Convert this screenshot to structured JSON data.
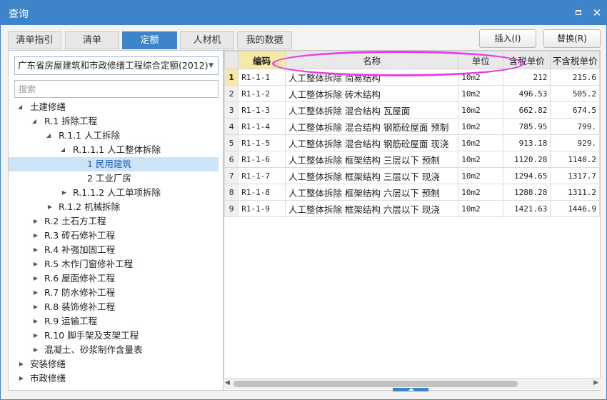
{
  "window": {
    "title": "查询",
    "minimize_symbol": "▫",
    "close_symbol": "✕",
    "accent": "#3d84c9"
  },
  "tabs": [
    {
      "label": "清单指引"
    },
    {
      "label": "清单"
    },
    {
      "label": "定额"
    },
    {
      "label": "人材机"
    },
    {
      "label": "我的数据"
    }
  ],
  "buttons": {
    "insert": "插入(I)",
    "replace": "替换(R)"
  },
  "left": {
    "quota_library": "广东省房屋建筑和市政修缮工程综合定额(2012)",
    "search_placeholder": "搜索",
    "tree": [
      {
        "label": "土建修缮",
        "icon": "expanded-triangle"
      },
      {
        "label": "R.1 拆除工程",
        "icon": "expanded-triangle"
      },
      {
        "label": "R.1.1 人工拆除",
        "icon": "expanded-triangle"
      },
      {
        "label": "R.1.1.1 人工整体拆除",
        "icon": "expanded-triangle"
      },
      {
        "label": "1 民用建筑",
        "icon": ""
      },
      {
        "label": "2 工业厂房",
        "icon": ""
      },
      {
        "label": "R.1.1.2 人工单项拆除",
        "icon": "collapsed-triangle"
      },
      {
        "label": "R.1.2 机械拆除",
        "icon": "collapsed-triangle"
      },
      {
        "label": "R.2 土石方工程",
        "icon": "collapsed-triangle"
      },
      {
        "label": "R.3 砖石修补工程",
        "icon": "collapsed-triangle"
      },
      {
        "label": "R.4 补强加固工程",
        "icon": "collapsed-triangle"
      },
      {
        "label": "R.5 木作门窗修补工程",
        "icon": "collapsed-triangle"
      },
      {
        "label": "R.6 屋面修补工程",
        "icon": "collapsed-triangle"
      },
      {
        "label": "R.7 防水修补工程",
        "icon": "collapsed-triangle"
      },
      {
        "label": "R.8 装饰修补工程",
        "icon": "collapsed-triangle"
      },
      {
        "label": "R.9 运输工程",
        "icon": "collapsed-triangle"
      },
      {
        "label": "R.10 脚手架及支架工程",
        "icon": "collapsed-triangle"
      },
      {
        "label": "混凝土、砂浆制作含量表",
        "icon": "collapsed-triangle"
      },
      {
        "label": "安装修缮",
        "icon": "collapsed-triangle"
      },
      {
        "label": "市政修缮",
        "icon": "collapsed-triangle"
      }
    ]
  },
  "grid": {
    "columns": [
      "编码",
      "名称",
      "单位",
      "含税单价",
      "不含税单价"
    ],
    "rows": [
      {
        "no": "1",
        "code": "R1-1-1",
        "name": "人工整体拆除 简易结构",
        "unit": "10m2",
        "tax_price": "212",
        "notax_price": "215.6"
      },
      {
        "no": "2",
        "code": "R1-1-2",
        "name": "人工整体拆除 砖木结构",
        "unit": "10m2",
        "tax_price": "496.53",
        "notax_price": "505.2"
      },
      {
        "no": "3",
        "code": "R1-1-3",
        "name": "人工整体拆除 混合结构 瓦屋面",
        "unit": "10m2",
        "tax_price": "662.82",
        "notax_price": "674.5"
      },
      {
        "no": "4",
        "code": "R1-1-4",
        "name": "人工整体拆除 混合结构 钢筋砼屋面 预制",
        "unit": "10m2",
        "tax_price": "785.95",
        "notax_price": "799."
      },
      {
        "no": "5",
        "code": "R1-1-5",
        "name": "人工整体拆除 混合结构 钢筋砼屋面 现浇",
        "unit": "10m2",
        "tax_price": "913.18",
        "notax_price": "929."
      },
      {
        "no": "6",
        "code": "R1-1-6",
        "name": "人工整体拆除 框架结构 三层以下 预制",
        "unit": "10m2",
        "tax_price": "1120.28",
        "notax_price": "1140.2"
      },
      {
        "no": "7",
        "code": "R1-1-7",
        "name": "人工整体拆除 框架结构 三层以下 现浇",
        "unit": "10m2",
        "tax_price": "1294.65",
        "notax_price": "1317.7"
      },
      {
        "no": "8",
        "code": "R1-1-8",
        "name": "人工整体拆除 框架结构 六层以下 预制",
        "unit": "10m2",
        "tax_price": "1288.28",
        "notax_price": "1311.2"
      },
      {
        "no": "9",
        "code": "R1-1-9",
        "name": "人工整体拆除 框架结构 六层以下 现浇",
        "unit": "10m2",
        "tax_price": "1421.63",
        "notax_price": "1446.9"
      }
    ]
  },
  "scrollbar": {
    "left_arrow": "◀",
    "right_arrow": "▶"
  },
  "annotation_color": "#e83ce8"
}
